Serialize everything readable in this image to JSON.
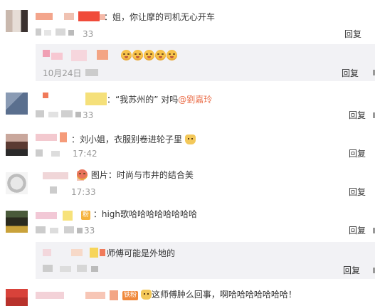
{
  "reply_label": "回复",
  "comments": [
    {
      "text": "：姐，你让摩的司机无心开车",
      "time": "33"
    },
    {
      "reply_text": "",
      "reply_time": "10月24日",
      "emoji_count": 5
    },
    {
      "text_quote": "：“我苏州的” 对吗",
      "mention": "@劉嘉玲",
      "time": "33"
    },
    {
      "text": "：刘小姐，衣服别卷进轮子里",
      "time": "17:42"
    },
    {
      "text": "图片：时尚与市井的结合美",
      "time": "17:33"
    },
    {
      "badge": "粉",
      "text": "：high歌哈哈哈哈哈哈哈哈",
      "time": "33"
    },
    {
      "reply_text": "师傅可能是外地的",
      "reply_time": ""
    },
    {
      "badge": "铁粉",
      "text": "这师傅肿么回事，啊哈哈哈哈哈哈哈！"
    }
  ],
  "icons": [
    "avatar-icon",
    "emoji-icon",
    "cat-emoji-icon",
    "fan-badge-icon"
  ]
}
